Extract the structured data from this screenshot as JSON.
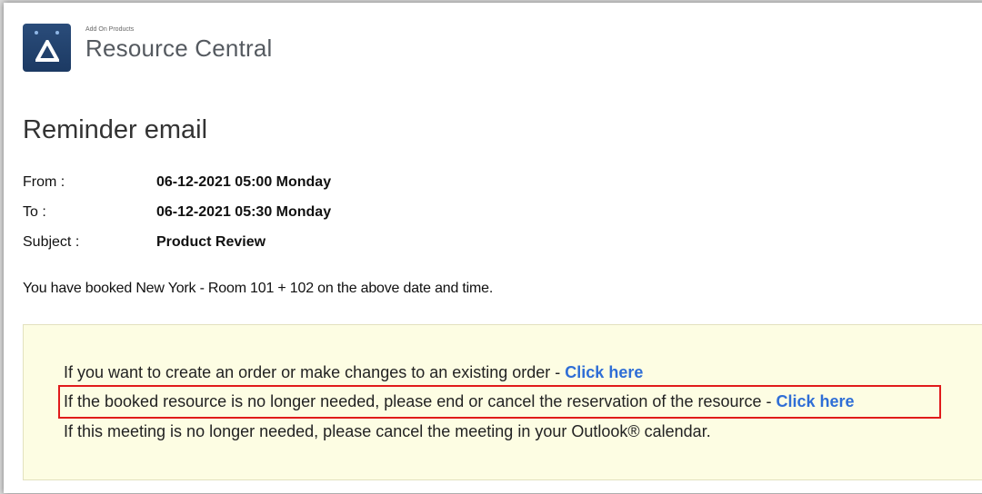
{
  "brand": {
    "small_label": "Add On Products",
    "name": "Resource Central"
  },
  "title": "Reminder email",
  "details": [
    {
      "label": "From :",
      "value": "06-12-2021 05:00 Monday"
    },
    {
      "label": "To :",
      "value": "06-12-2021 05:30 Monday"
    },
    {
      "label": "Subject :",
      "value": "Product Review"
    }
  ],
  "booked_text": "You have booked New York - Room 101 + 102 on the above date and time.",
  "notice": {
    "line1_text": "If you want to create an order or make changes to an existing order - ",
    "line1_link": "Click here",
    "line2_text": "If the booked resource is no longer needed, please end or cancel the reservation of the resource - ",
    "line2_link": "Click here",
    "line3_text": "If this meeting is no longer needed, please cancel the meeting in your Outlook® calendar."
  },
  "colors": {
    "link": "#2f6ed6",
    "highlight_border": "#e01b1b",
    "notice_background": "#fdfde3",
    "logo_background": "#1c3a63"
  },
  "icons": {
    "logo": "triangle-logo-icon"
  }
}
